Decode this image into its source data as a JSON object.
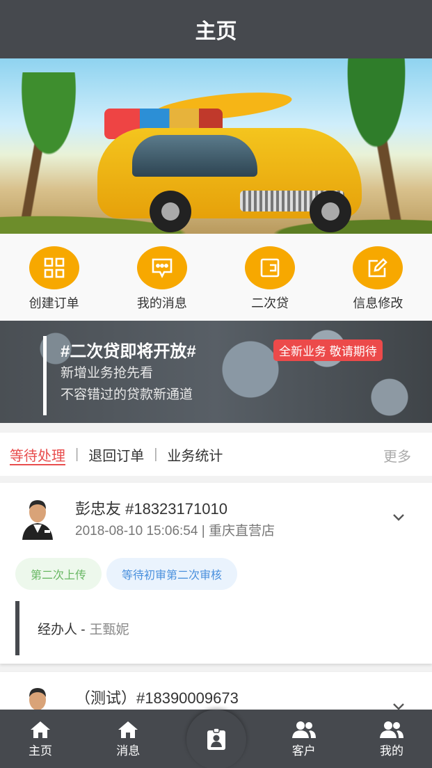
{
  "header": {
    "title": "主页"
  },
  "banner": {
    "slide_count": 3,
    "active_slide": 2
  },
  "quick_actions": [
    {
      "label": "创建订单",
      "icon": "grid-icon"
    },
    {
      "label": "我的消息",
      "icon": "chat-bubble-icon"
    },
    {
      "label": "二次贷",
      "icon": "wallet-icon"
    },
    {
      "label": "信息修改",
      "icon": "edit-icon"
    }
  ],
  "promo": {
    "title": "#二次贷即将开放#",
    "badge": "全新业务 敬请期待",
    "line1": "新增业务抢先看",
    "line2": "不容错过的贷款新通道"
  },
  "tabs": {
    "items": [
      "等待处理",
      "退回订单",
      "业务统计"
    ],
    "separator": "|",
    "active": 0,
    "more": "更多"
  },
  "cards": [
    {
      "name": "彭忠友 #18323171010",
      "datetime": "2018-08-10 15:06:54",
      "meta_separator": "|",
      "store": "重庆直营店",
      "tags": [
        "第二次上传",
        "等待初审第二次审核"
      ],
      "handler_label": "经办人 -",
      "handler_name": "王甄妮"
    },
    {
      "name": "（测试）#18390009673"
    }
  ],
  "tabbar": {
    "items": [
      {
        "label": "主页",
        "icon": "home-icon"
      },
      {
        "label": "消息",
        "icon": "home-icon"
      },
      {
        "label": "",
        "icon": "contact-card-icon"
      },
      {
        "label": "客户",
        "icon": "users-icon"
      },
      {
        "label": "我的",
        "icon": "users-icon"
      }
    ]
  },
  "colors": {
    "header_bg": "#46494e",
    "accent_orange": "#f7a800",
    "active_tab_red": "#e84d4d",
    "badge_red": "#ec4a4a",
    "tag_green_text": "#68b763",
    "tag_blue_text": "#4a90dd"
  }
}
